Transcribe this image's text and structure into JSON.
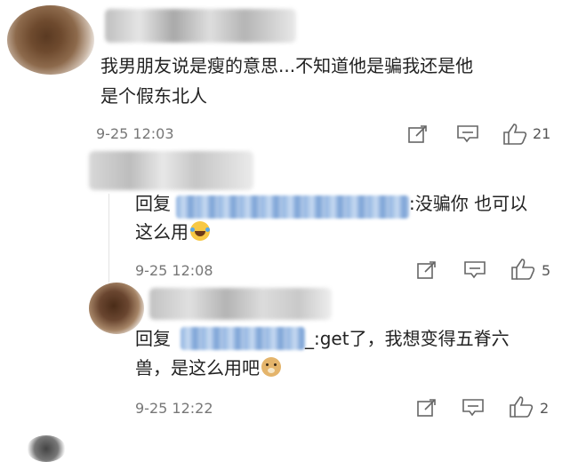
{
  "comments": [
    {
      "text_line1": "我男朋友说是瘦的意思...不知道他是骗我还是他",
      "text_line2": "是个假东北人",
      "time": "9-25 12:03",
      "likes": "21"
    }
  ],
  "replies": [
    {
      "prefix": "回复",
      "suffix_line1": ":没骗你 也可以",
      "line2": "这么用",
      "emoji": "laughing-tears-emoji",
      "time": "9-25 12:08",
      "likes": "5"
    },
    {
      "prefix": "回复",
      "suffix_line1": "_:get了，我想变得五脊六",
      "line2": "兽，是这么用吧",
      "emoji": "doge-emoji",
      "time": "9-25 12:22",
      "likes": "2"
    }
  ],
  "icons": {
    "share": "share-icon",
    "reply": "comment-icon",
    "like": "thumbs-up-icon"
  }
}
